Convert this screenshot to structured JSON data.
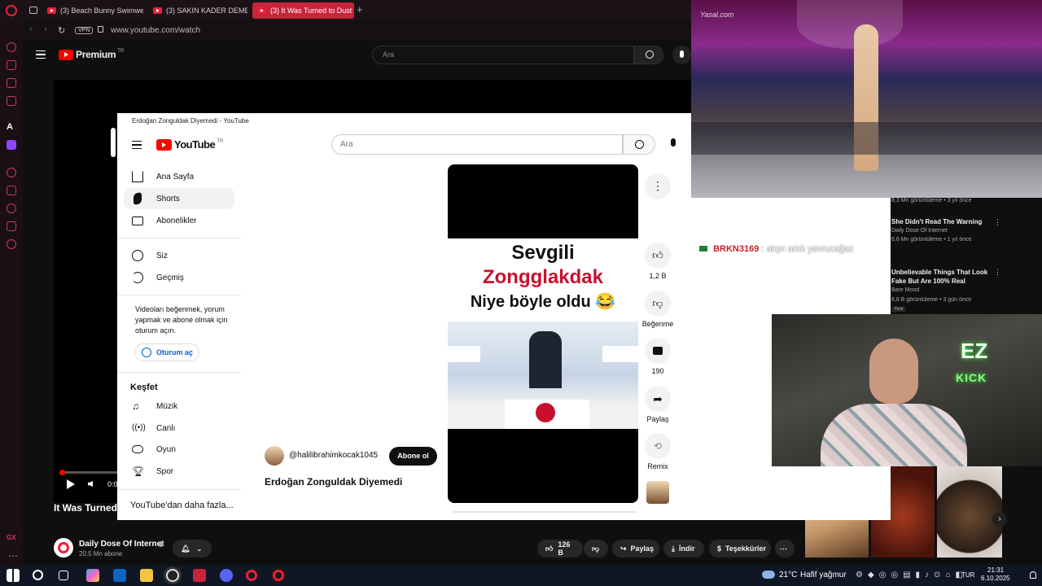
{
  "browser": {
    "tabs": [
      {
        "label": "(3) Beach Bunny Swimwe"
      },
      {
        "label": "(3) SAKIN KADER DEME"
      },
      {
        "label": "(3) It Was Turned to Dust"
      }
    ],
    "vpn_label": "VPN",
    "url": "www.youtube.com/watch"
  },
  "youtube_bg": {
    "logo": "Premium",
    "logo_sup": "TR",
    "search_placeholder": "Ara",
    "video_title": "It Was Turned t",
    "channel_name": "Daily Dose Of Internet",
    "channel_subs": "20,5 Mn abone",
    "time_label": "0:0",
    "likes": "126 B",
    "share_label": "Paylaş",
    "download_label": "İndir",
    "thanks_label": "Teşekkürler"
  },
  "popup": {
    "window_title": "Erdoğan Zonguldak Diyemedi - YouTube",
    "logo": "YouTube",
    "logo_sup": "TR",
    "search_placeholder": "Ara",
    "nav": [
      {
        "label": "Ana Sayfa"
      },
      {
        "label": "Shorts"
      },
      {
        "label": "Abonelikler"
      },
      {
        "label": "Siz"
      },
      {
        "label": "Geçmiş"
      }
    ],
    "signin_prompt": "Videoları beğenmek, yorum yapmak ve abone olmak için oturum açın.",
    "signin_button": "Oturum aç",
    "explore_title": "Keşfet",
    "explore": [
      {
        "label": "Müzik"
      },
      {
        "label": "Canlı"
      },
      {
        "label": "Oyun"
      },
      {
        "label": "Spor"
      }
    ],
    "more_label": "YouTube'dan daha fazla...",
    "short": {
      "caption_line1": "Sevgili",
      "caption_line2": "Zongglakdak",
      "caption_line3": "Niye böyle oldu 😂",
      "channel": "@halilibrahimkocak1045",
      "subscribe": "Abone ol",
      "title": "Erdoğan Zonguldak Diyemedi"
    },
    "actions": {
      "likes": "1,2 B",
      "dislike": "Beğenme",
      "comments": "190",
      "share": "Paylaş",
      "remix": "Remix"
    }
  },
  "overlay": {
    "watermark": "Yasal.com",
    "chat_user": "BRKN3169",
    "chat_msg": ": alışn artık yavrucağaz",
    "recs": [
      {
        "meta": "8,3 Mn görüntüleme • 3 yıl önce"
      },
      {
        "title": "She Didn't Read The Warning",
        "channel": "Daily Dose Of Internet",
        "meta": "6,6 Mn görüntüleme • 1 yıl önce"
      },
      {
        "title": "Unbelievable Things That Look Fake But Are 100% Real",
        "channel": "Bare Mood",
        "meta": "6,8 B görüntüleme • 3 gün önce",
        "badge": "Yeni"
      }
    ],
    "neon": "EZ",
    "neon2": "KICK"
  },
  "taskbar": {
    "weather": "21°C",
    "weather_desc": "Hafif yağmur",
    "lang": "TUR",
    "time": "21:31",
    "date": "6.10.2025"
  }
}
